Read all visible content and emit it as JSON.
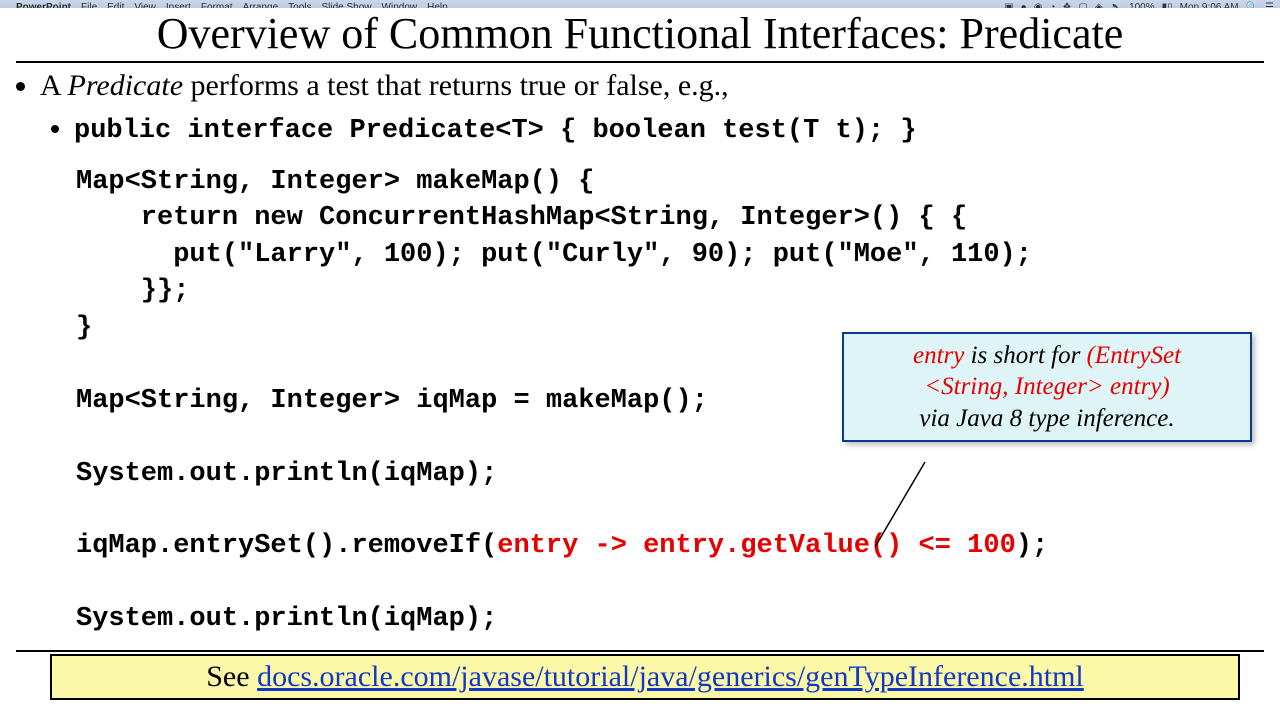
{
  "menubar": {
    "appname": "PowerPoint",
    "items": [
      "File",
      "Edit",
      "View",
      "Insert",
      "Format",
      "Arrange",
      "Tools",
      "Slide Show",
      "Window",
      "Help"
    ],
    "battery": "100%",
    "clock": "Mon 9:06 AM"
  },
  "slide": {
    "title": "Overview of Common Functional Interfaces: Predicate",
    "bullet1_pre": "A ",
    "bullet1_em": "Predicate",
    "bullet1_post": " performs a test that returns true or false, e.g.,",
    "sub_sig": "public interface Predicate<T> { boolean test(T t); }",
    "code_l1": "Map<String, Integer> makeMap() {",
    "code_l2": "    return new ConcurrentHashMap<String, Integer>() { {",
    "code_l3": "      put(\"Larry\", 100); put(\"Curly\", 90); put(\"Moe\", 110);",
    "code_l4": "    }};",
    "code_l5": "}",
    "code_l6": "",
    "code_l7": "Map<String, Integer> iqMap = makeMap();",
    "code_l8": "",
    "code_l9": "System.out.println(iqMap);",
    "code_l10": "",
    "code_l11a": "iqMap.entrySet().removeIf(",
    "code_l11b": "entry -> entry.getValue() <= 100",
    "code_l11c": ");",
    "code_l12": "",
    "code_l13": "System.out.println(iqMap);",
    "callout_p1a": "entry",
    "callout_p1b": " is short for ",
    "callout_p1c": "(EntrySet",
    "callout_p2a": "<String, Integer> entry)",
    "callout_p3": "via Java 8 type inference.",
    "footer_see": "See ",
    "footer_url": "docs.oracle.com/javase/tutorial/java/generics/genTypeInference.html"
  }
}
